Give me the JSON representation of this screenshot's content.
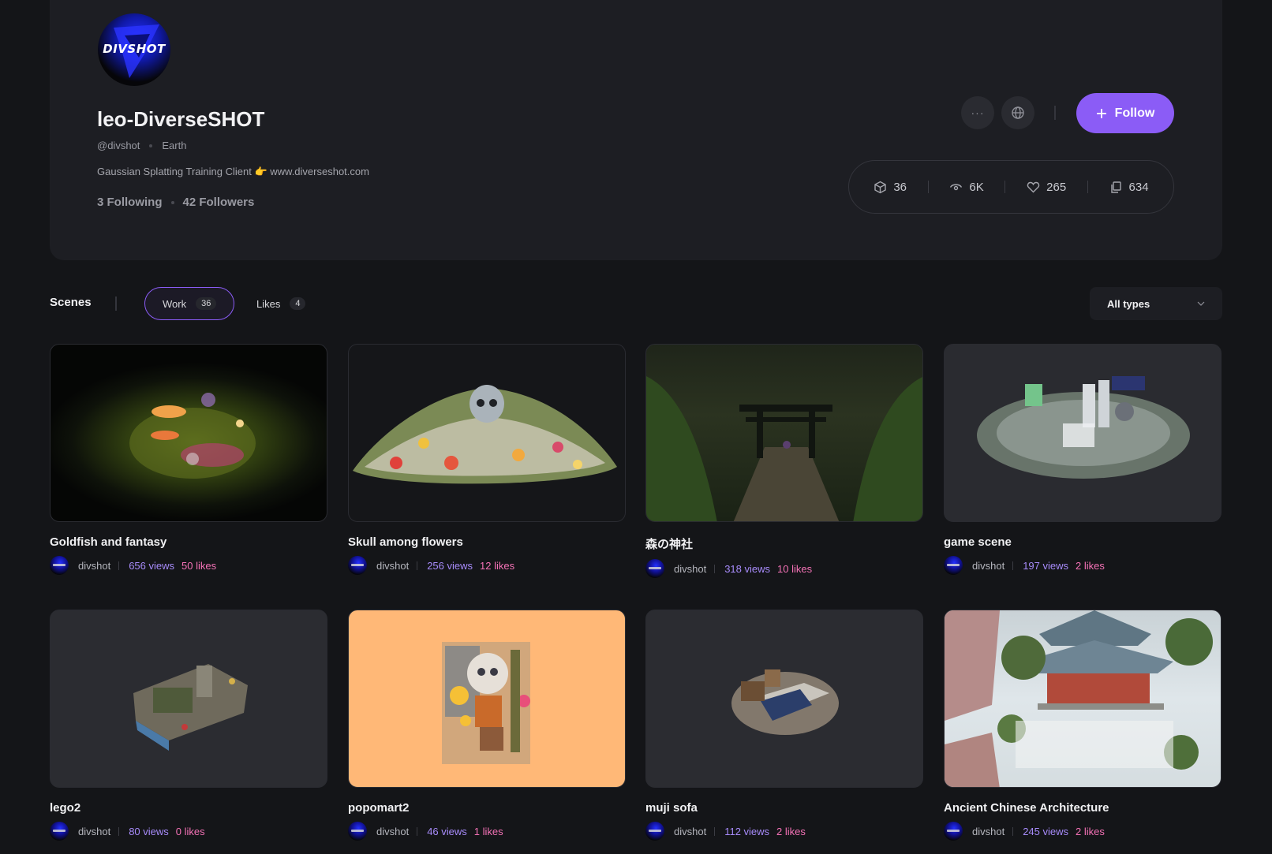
{
  "profile": {
    "avatar_text": "DIVSHOT",
    "name": "leo-DiverseSHOT",
    "handle": "@divshot",
    "location": "Earth",
    "bio": "Gaussian Splatting Training Client 👉 www.diverseshot.com",
    "following": "3 Following",
    "followers": "42 Followers"
  },
  "actions": {
    "more_label": "···",
    "follow_label": "Follow"
  },
  "stats": {
    "scenes": "36",
    "views": "6K",
    "likes": "265",
    "copies": "634"
  },
  "scenes_bar": {
    "title": "Scenes",
    "tabs": [
      {
        "label": "Work",
        "count": "36"
      },
      {
        "label": "Likes",
        "count": "4"
      }
    ],
    "type_filter": "All types"
  },
  "cards": [
    {
      "title": "Goldfish and fantasy",
      "author": "divshot",
      "views": "656 views",
      "likes": "50 likes"
    },
    {
      "title": "Skull among flowers",
      "author": "divshot",
      "views": "256 views",
      "likes": "12 likes"
    },
    {
      "title": "森の神社",
      "author": "divshot",
      "views": "318 views",
      "likes": "10 likes"
    },
    {
      "title": "game scene",
      "author": "divshot",
      "views": "197 views",
      "likes": "2 likes"
    },
    {
      "title": "lego2",
      "author": "divshot",
      "views": "80 views",
      "likes": "0 likes"
    },
    {
      "title": "popomart2",
      "author": "divshot",
      "views": "46 views",
      "likes": "1 likes"
    },
    {
      "title": "muji sofa",
      "author": "divshot",
      "views": "112 views",
      "likes": "2 likes"
    },
    {
      "title": "Ancient Chinese Architecture",
      "author": "divshot",
      "views": "245 views",
      "likes": "2 likes"
    }
  ],
  "colors": {
    "accent": "#8b5cf6",
    "views": "#a78bfa",
    "likes": "#f472b6",
    "background": "#141518"
  }
}
